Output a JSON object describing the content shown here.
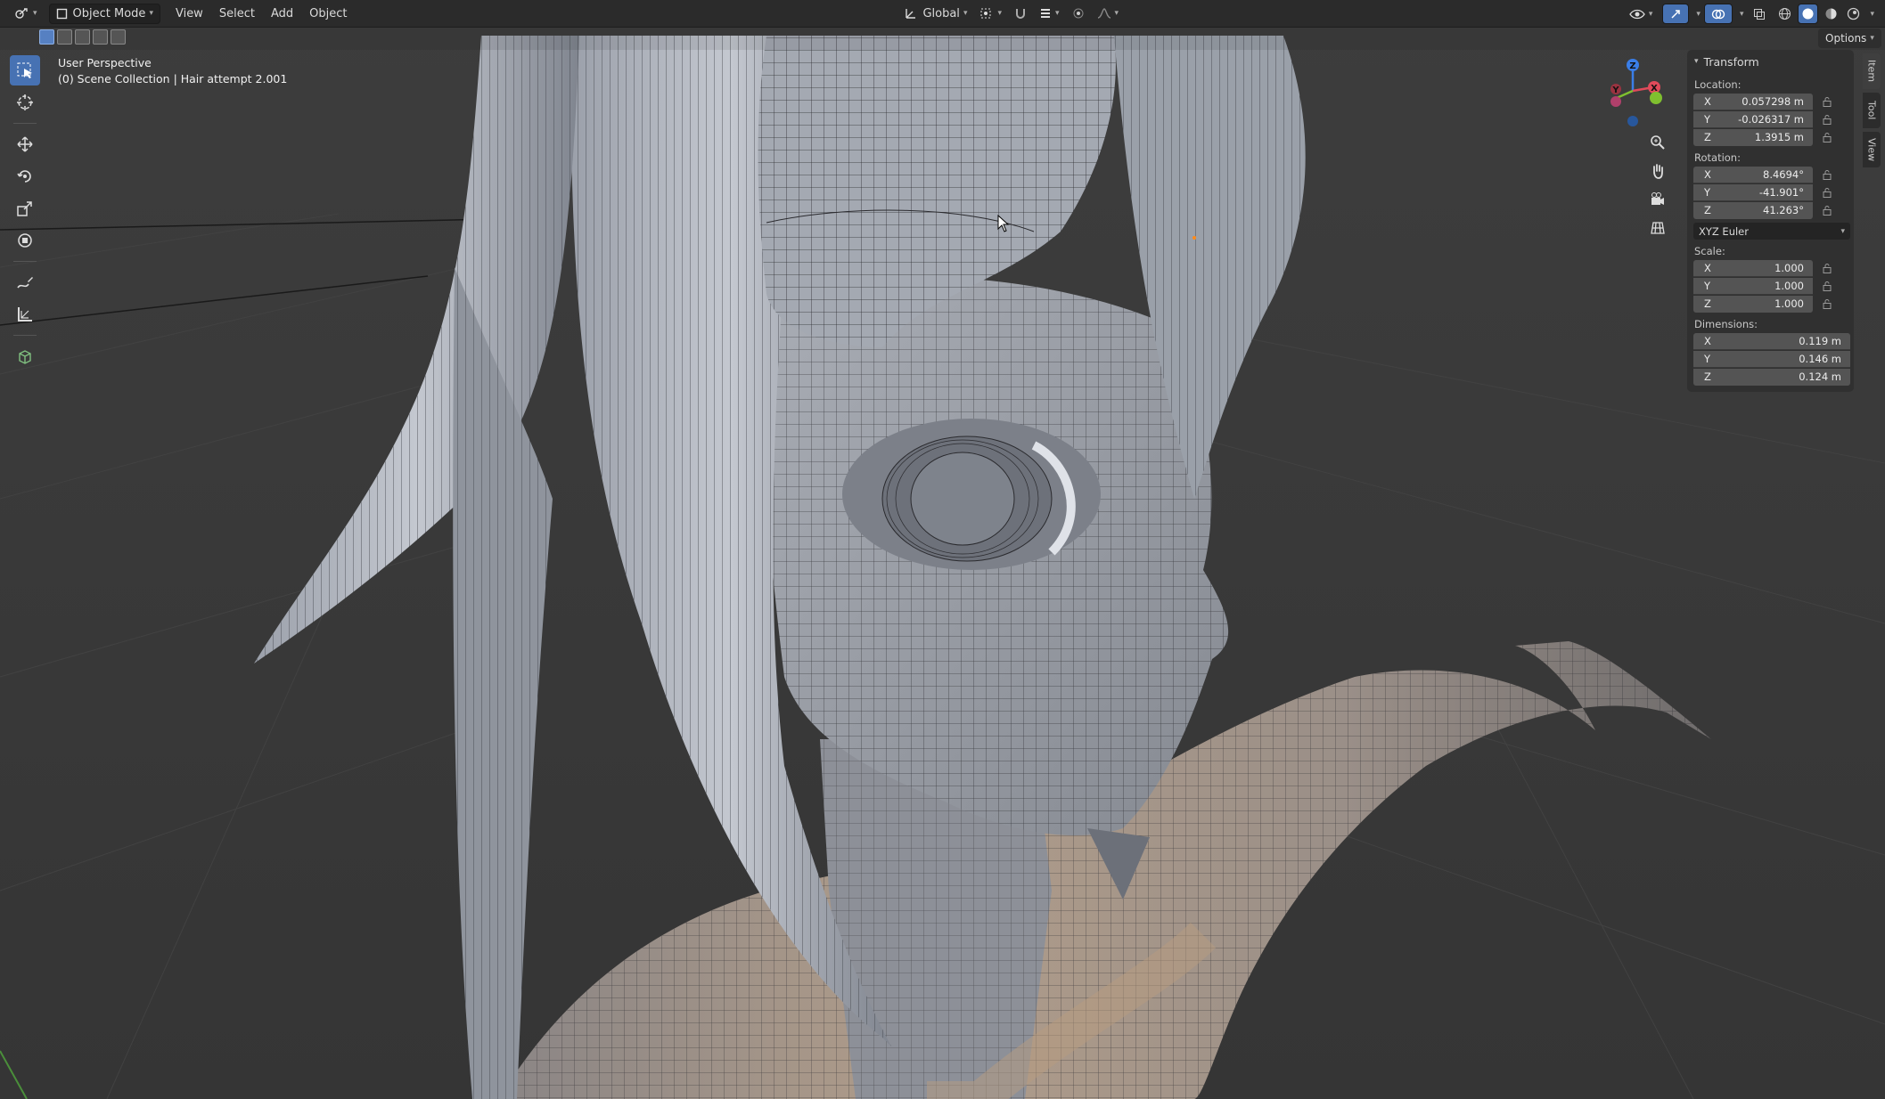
{
  "header": {
    "editor_type_icon": "3d-viewport-icon",
    "mode": "Object Mode",
    "menus": [
      "View",
      "Select",
      "Add",
      "Object"
    ],
    "orientation": "Global",
    "options_label": "Options"
  },
  "viewport": {
    "perspective": "User Perspective",
    "collection": "(0) Scene Collection | Hair attempt 2.001"
  },
  "toolbar": {
    "tools": [
      "select-box-icon",
      "cursor-icon",
      "move-icon",
      "rotate-icon",
      "scale-icon",
      "transform-icon",
      "annotate-icon",
      "measure-icon",
      "add-cube-icon"
    ]
  },
  "gizmo": {
    "axes": [
      "X",
      "Y",
      "Z"
    ],
    "colors": {
      "x": "#e04a5a",
      "y": "#7fbf2f",
      "z": "#3a7ee8"
    }
  },
  "npanel": {
    "title": "Transform",
    "location": {
      "label": "Location:",
      "x": "0.057298 m",
      "y": "-0.026317 m",
      "z": "1.3915 m"
    },
    "rotation": {
      "label": "Rotation:",
      "x": "8.4694°",
      "y": "-41.901°",
      "z": "41.263°"
    },
    "rotation_mode": "XYZ Euler",
    "scale": {
      "label": "Scale:",
      "x": "1.000",
      "y": "1.000",
      "z": "1.000"
    },
    "dimensions": {
      "label": "Dimensions:",
      "x": "0.119 m",
      "y": "0.146 m",
      "z": "0.124 m"
    },
    "axis_letters": {
      "x": "X",
      "y": "Y",
      "z": "Z"
    }
  },
  "sidetabs": [
    "Item",
    "Tool",
    "View"
  ],
  "colors": {
    "accent": "#4772b3",
    "header_bg": "#2b2b2b",
    "panel_bg": "#303030",
    "field_bg": "#545454"
  }
}
